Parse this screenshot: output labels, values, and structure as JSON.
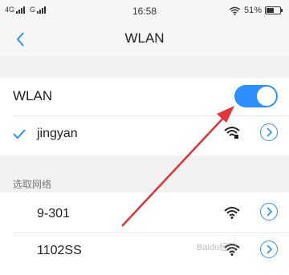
{
  "status_bar": {
    "sim1": "4G",
    "sim2": "G",
    "time": "16:58",
    "battery": "51%",
    "battery_level": 0.51
  },
  "nav": {
    "title": "WLAN"
  },
  "wlan_toggle": {
    "label": "WLAN",
    "state": "on"
  },
  "connected_network": {
    "ssid": "jingyan",
    "icon": "wifi-locked-icon"
  },
  "available_section": {
    "title": "选取网络",
    "networks": [
      {
        "ssid": "9-301",
        "icon": "wifi-icon"
      },
      {
        "ssid": "1102SS",
        "icon": "wifi-icon"
      }
    ]
  },
  "watermark": "Baidu经验",
  "colors": {
    "accent": "#2e90ff",
    "annotation_arrow": "#e0333a",
    "background": "#f2f2f2"
  }
}
